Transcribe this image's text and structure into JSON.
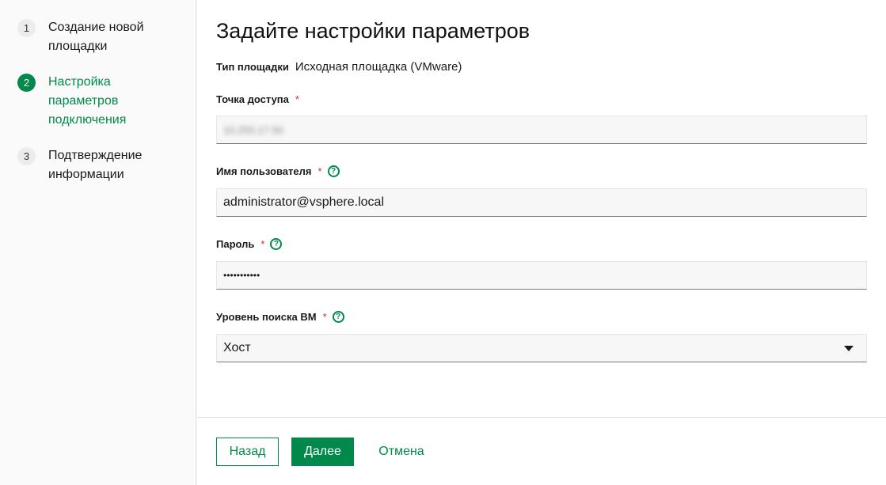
{
  "steps": [
    {
      "num": "1",
      "label": "Создание новой площадки",
      "active": false
    },
    {
      "num": "2",
      "label": "Настройка параметров подключения",
      "active": true
    },
    {
      "num": "3",
      "label": "Подтверждение информации",
      "active": false
    }
  ],
  "page_title": "Задайте настройки параметров",
  "site_type": {
    "label": "Тип площадки",
    "value": "Исходная площадка (VMware)"
  },
  "access_point": {
    "label": "Точка доступа",
    "required": "*",
    "value": "10.250.17.50"
  },
  "username": {
    "label": "Имя пользователя",
    "required": "*",
    "help": "?",
    "value": "administrator@vsphere.local"
  },
  "password": {
    "label": "Пароль",
    "required": "*",
    "help": "?",
    "value": "•••••••••••"
  },
  "vm_search": {
    "label": "Уровень поиска ВМ",
    "required": "*",
    "help": "?",
    "value": "Хост"
  },
  "footer": {
    "back": "Назад",
    "next": "Далее",
    "cancel": "Отмена"
  },
  "colors": {
    "accent": "#01894b",
    "required": "#d62d2d"
  }
}
